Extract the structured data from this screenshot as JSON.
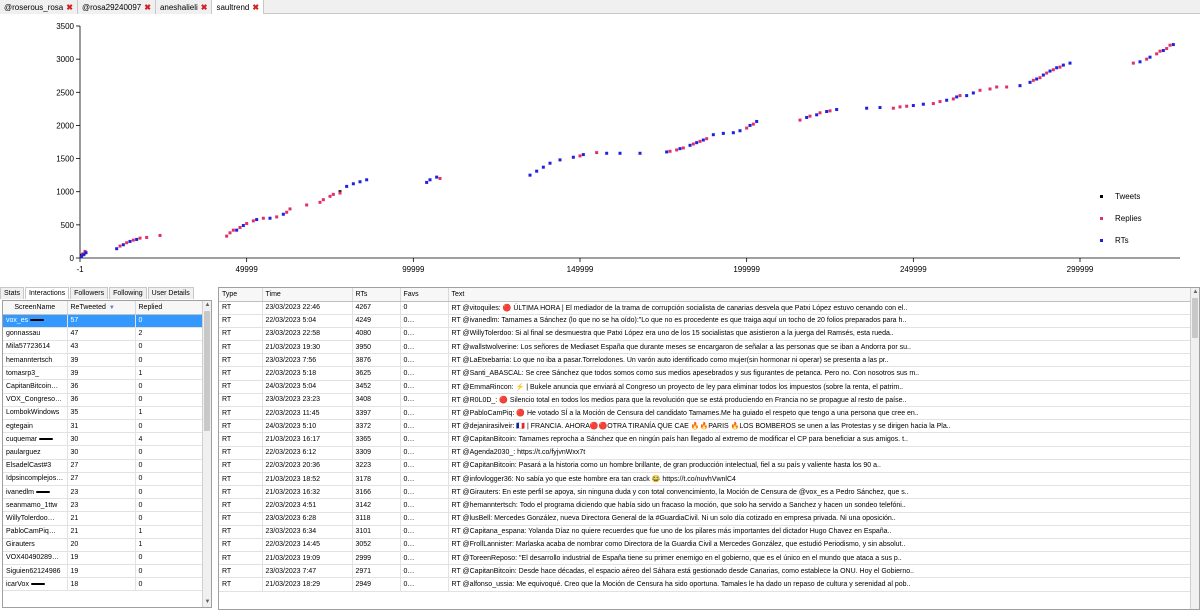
{
  "tabs": [
    {
      "label": "@roserous_rosa",
      "active": false
    },
    {
      "label": "@rosa29240097",
      "active": false
    },
    {
      "label": "aneshalieli",
      "active": false
    },
    {
      "label": "saultrend",
      "active": true
    }
  ],
  "close_icon": "close-icon",
  "chart_data": {
    "type": "scatter",
    "xlim": [
      -1,
      330000
    ],
    "ylim": [
      0,
      3500
    ],
    "x_ticks": [
      -1,
      49999,
      99999,
      149999,
      199999,
      249999,
      299999
    ],
    "x_tick_labels": [
      "-1",
      "49999",
      "99999",
      "149999",
      "199999",
      "249999",
      "299999"
    ],
    "y_ticks": [
      0,
      500,
      1000,
      1500,
      2000,
      2500,
      3000,
      3500
    ],
    "y_tick_labels": [
      "0",
      "500",
      "1000",
      "1500",
      "2000",
      "2500",
      "3000",
      "3500"
    ],
    "legend_position": "right",
    "series": [
      {
        "name": "Tweets",
        "color": "#000000",
        "points": [
          [
            500,
            40
          ],
          [
            1200,
            60
          ],
          [
            78000,
            1000
          ]
        ]
      },
      {
        "name": "Replies",
        "color": "#e0306a",
        "points": [
          [
            800,
            60
          ],
          [
            1500,
            100
          ],
          [
            12000,
            180
          ],
          [
            14000,
            230
          ],
          [
            16000,
            270
          ],
          [
            18000,
            300
          ],
          [
            20000,
            310
          ],
          [
            24000,
            340
          ],
          [
            44000,
            330
          ],
          [
            45000,
            380
          ],
          [
            46000,
            420
          ],
          [
            48000,
            460
          ],
          [
            50000,
            520
          ],
          [
            52000,
            560
          ],
          [
            55000,
            600
          ],
          [
            59000,
            620
          ],
          [
            62000,
            690
          ],
          [
            63000,
            740
          ],
          [
            68000,
            800
          ],
          [
            72000,
            840
          ],
          [
            73000,
            880
          ],
          [
            75000,
            930
          ],
          [
            76000,
            960
          ],
          [
            78000,
            980
          ],
          [
            108000,
            1200
          ],
          [
            150000,
            1540
          ],
          [
            155000,
            1590
          ],
          [
            177000,
            1610
          ],
          [
            179000,
            1630
          ],
          [
            181000,
            1660
          ],
          [
            184000,
            1720
          ],
          [
            186000,
            1760
          ],
          [
            188000,
            1800
          ],
          [
            200000,
            1960
          ],
          [
            202000,
            2020
          ],
          [
            216000,
            2080
          ],
          [
            219000,
            2140
          ],
          [
            222000,
            2190
          ],
          [
            225000,
            2220
          ],
          [
            244000,
            2260
          ],
          [
            246000,
            2280
          ],
          [
            248000,
            2290
          ],
          [
            256000,
            2330
          ],
          [
            258000,
            2360
          ],
          [
            262000,
            2400
          ],
          [
            264000,
            2450
          ],
          [
            270000,
            2530
          ],
          [
            273000,
            2550
          ],
          [
            275000,
            2580
          ],
          [
            278000,
            2580
          ],
          [
            286000,
            2680
          ],
          [
            288000,
            2720
          ],
          [
            290000,
            2790
          ],
          [
            292000,
            2840
          ],
          [
            294000,
            2880
          ],
          [
            316000,
            2940
          ],
          [
            320000,
            3000
          ],
          [
            323000,
            3080
          ],
          [
            324000,
            3120
          ],
          [
            326000,
            3160
          ],
          [
            327000,
            3210
          ]
        ]
      },
      {
        "name": "RTs",
        "color": "#2020e0",
        "points": [
          [
            400,
            20
          ],
          [
            1000,
            50
          ],
          [
            1800,
            80
          ],
          [
            11000,
            140
          ],
          [
            13000,
            200
          ],
          [
            15000,
            250
          ],
          [
            17000,
            280
          ],
          [
            47000,
            420
          ],
          [
            49000,
            490
          ],
          [
            53000,
            580
          ],
          [
            57000,
            600
          ],
          [
            61000,
            660
          ],
          [
            80000,
            1080
          ],
          [
            82000,
            1120
          ],
          [
            84000,
            1150
          ],
          [
            86000,
            1180
          ],
          [
            104000,
            1140
          ],
          [
            105000,
            1180
          ],
          [
            107000,
            1220
          ],
          [
            135000,
            1250
          ],
          [
            137000,
            1310
          ],
          [
            139000,
            1370
          ],
          [
            141000,
            1430
          ],
          [
            144000,
            1480
          ],
          [
            148000,
            1520
          ],
          [
            151000,
            1560
          ],
          [
            158000,
            1580
          ],
          [
            162000,
            1580
          ],
          [
            168000,
            1580
          ],
          [
            176000,
            1600
          ],
          [
            180000,
            1650
          ],
          [
            183000,
            1700
          ],
          [
            185000,
            1740
          ],
          [
            187000,
            1780
          ],
          [
            190000,
            1860
          ],
          [
            193000,
            1880
          ],
          [
            196000,
            1890
          ],
          [
            198000,
            1920
          ],
          [
            201000,
            2000
          ],
          [
            203000,
            2060
          ],
          [
            218000,
            2120
          ],
          [
            221000,
            2160
          ],
          [
            224000,
            2210
          ],
          [
            227000,
            2240
          ],
          [
            236000,
            2260
          ],
          [
            240000,
            2270
          ],
          [
            250000,
            2300
          ],
          [
            253000,
            2320
          ],
          [
            260000,
            2380
          ],
          [
            263000,
            2430
          ],
          [
            266000,
            2450
          ],
          [
            268000,
            2490
          ],
          [
            282000,
            2600
          ],
          [
            285000,
            2650
          ],
          [
            287000,
            2700
          ],
          [
            289000,
            2760
          ],
          [
            291000,
            2820
          ],
          [
            293000,
            2870
          ],
          [
            295000,
            2910
          ],
          [
            297000,
            2940
          ],
          [
            318000,
            2960
          ],
          [
            321000,
            3030
          ],
          [
            325000,
            3130
          ],
          [
            328000,
            3220
          ]
        ]
      }
    ]
  },
  "left_tabs": [
    {
      "label": "Stats",
      "active": false
    },
    {
      "label": "Interactions",
      "active": true
    },
    {
      "label": "Followers",
      "active": false
    },
    {
      "label": "Following",
      "active": false
    },
    {
      "label": "User Details",
      "active": false
    }
  ],
  "interactions": {
    "headers": {
      "screen_name": "ScreenName",
      "retweeted": "ReTweeted",
      "replied": "Replied"
    },
    "rows": [
      {
        "name": "vox_es",
        "rt": "57",
        "rep": "0",
        "selected": true,
        "redacted": true
      },
      {
        "name": "gonnassau",
        "rt": "47",
        "rep": "2"
      },
      {
        "name": "Mila57723614",
        "rt": "43",
        "rep": "0"
      },
      {
        "name": "hemanntertsch",
        "rt": "39",
        "rep": "0"
      },
      {
        "name": "tomasrp3_",
        "rt": "39",
        "rep": "1"
      },
      {
        "name": "CapitanBitcoin",
        "rt": "36",
        "rep": "0",
        "redacted": true
      },
      {
        "name": "VOX_Congreso",
        "rt": "36",
        "rep": "0",
        "redacted": true
      },
      {
        "name": "LombokWindows",
        "rt": "35",
        "rep": "1"
      },
      {
        "name": "egtegain",
        "rt": "31",
        "rep": "0"
      },
      {
        "name": "cuquemar",
        "rt": "30",
        "rep": "4",
        "redacted": true
      },
      {
        "name": "paularguez",
        "rt": "30",
        "rep": "0"
      },
      {
        "name": "ElsadelCast#3",
        "rt": "27",
        "rep": "0"
      },
      {
        "name": "Idpsincomplejos",
        "rt": "27",
        "rep": "0",
        "redacted": true
      },
      {
        "name": "ivanedlm",
        "rt": "23",
        "rep": "0",
        "redacted": true
      },
      {
        "name": "seanmamo_1ttw",
        "rt": "23",
        "rep": "0"
      },
      {
        "name": "WillyTolerdoo",
        "rt": "21",
        "rep": "0",
        "redacted": true
      },
      {
        "name": "PabloCamPiq",
        "rt": "21",
        "rep": "1",
        "redacted": true
      },
      {
        "name": "Girauters",
        "rt": "20",
        "rep": "1"
      },
      {
        "name": "VOX40490289",
        "rt": "19",
        "rep": "0",
        "redacted": true
      },
      {
        "name": "Siguien62124986",
        "rt": "19",
        "rep": "0"
      },
      {
        "name": "icarVox",
        "rt": "18",
        "rep": "0",
        "redacted": true
      }
    ]
  },
  "tweets": {
    "headers": {
      "type": "Type",
      "time": "Time",
      "rts": "RTs",
      "favs": "Favs",
      "text": "Text"
    },
    "rows": [
      {
        "type": "RT",
        "time": "23/03/2023 22:46",
        "rts": "4267",
        "favs": "0",
        "text": "RT @vitoquiles: 🔴 ÚLTIMA HORA | El mediador de la trama de corrupción socialista de canarias desvela que Patxi López estuvo cenando con el..",
        "mark": false
      },
      {
        "type": "RT",
        "time": "22/03/2023 5:04",
        "rts": "4249",
        "favs": "0",
        "text": "RT @ivanedlm: Tamames a Sánchez (lo que no se ha oído):\"Lo que no es procedente es que traiga aquí un tocho de 20 folios preparados para h..",
        "mark": true
      },
      {
        "type": "RT",
        "time": "23/03/2023 22:58",
        "rts": "4080",
        "favs": "0",
        "text": "RT @WillyTolerdoo: Si al final se desmuestra que Patxi López era uno de los 15 socialistas que asistieron a la juerga del Ramsés, esta rueda..",
        "mark": true
      },
      {
        "type": "RT",
        "time": "21/03/2023 19:30",
        "rts": "3950",
        "favs": "0",
        "text": "RT @wallstwolverine: Los señores de Mediaset España que durante meses se encargaron de señalar a las personas que se iban a Andorra por su..",
        "mark": true
      },
      {
        "type": "RT",
        "time": "23/03/2023 7:56",
        "rts": "3876",
        "favs": "0",
        "text": "RT @LaEtxebarria: Lo que no iba a pasar.Torrelodones. Un varón auto identificado como mujer(sin hormonar ni operar) se presenta a las pr..",
        "mark": true
      },
      {
        "type": "RT",
        "time": "22/03/2023 5:18",
        "rts": "3625",
        "favs": "0",
        "text": "RT @Santi_ABASCAL: Se cree Sánchez que todos somos como sus medios apesebrados y sus figurantes de petanca. Pero no. Con nosotros sus m..",
        "mark": true
      },
      {
        "type": "RT",
        "time": "24/03/2023 5:04",
        "rts": "3452",
        "favs": "0",
        "text": "RT @EmmaRincon: ⚡ | Bukele anuncia que enviará al Congreso un proyecto de ley para eliminar todos los impuestos (sobre la renta, el patrim..",
        "mark": true
      },
      {
        "type": "RT",
        "time": "23/03/2023 23:23",
        "rts": "3408",
        "favs": "0",
        "text": "RT @R0L0D_: 🔴 Silencio total en todos los medios para que la revolución que se está produciendo en Francia no se propague al resto de paíse..",
        "mark": true
      },
      {
        "type": "RT",
        "time": "22/03/2023 11:45",
        "rts": "3397",
        "favs": "0",
        "text": "RT @PabloCamPiq: 🔴 He votado SÍ a la Moción de Censura del candidato Tamames.Me ha guiado el respeto que tengo a una persona que cree en..",
        "mark": true
      },
      {
        "type": "RT",
        "time": "24/03/2023 5:10",
        "rts": "3372",
        "favs": "0",
        "text": "RT @dejanirasilveir: 🇫🇷 | FRANCIA. AHORA🔴🔴OTRA TIRANÍA QUE CAE 🔥🔥PARIS 🔥LOS BOMBEROS se unen a las Protestas y se dirigen hacia la Pla..",
        "mark": true
      },
      {
        "type": "RT",
        "time": "21/03/2023 16:17",
        "rts": "3365",
        "favs": "0",
        "text": "RT @CapitanBitcoin: Tamames reprocha a Sánchez que en ningún país han llegado al extremo de modificar el CP para beneficiar a sus amigos. t..",
        "mark": true
      },
      {
        "type": "RT",
        "time": "22/03/2023 6:12",
        "rts": "3309",
        "favs": "0",
        "text": "RT @Agenda2030_: https://t.co/fyjvnWxx7t",
        "mark": true
      },
      {
        "type": "RT",
        "time": "22/03/2023 20:36",
        "rts": "3223",
        "favs": "0",
        "text": "RT @CapitanBitcoin: Pasará a la historia como un hombre brillante, de gran producción intelectual, fiel a su país y valiente hasta los 90 a..",
        "mark": true
      },
      {
        "type": "RT",
        "time": "21/03/2023 18:52",
        "rts": "3178",
        "favs": "0",
        "text": "RT @infovlogger36: No sabía yo que este hombre era tan crack 😂 https://t.co/nuvhVwnlC4",
        "mark": true
      },
      {
        "type": "RT",
        "time": "21/03/2023 16:32",
        "rts": "3166",
        "favs": "0",
        "text": "RT @Girauters: En este perfil se apoya, sin ninguna duda y con total convencimiento, la Moción de Censura de @vox_es a Pedro Sánchez, que s..",
        "mark": true
      },
      {
        "type": "RT",
        "time": "22/03/2023 4:51",
        "rts": "3142",
        "favs": "0",
        "text": "RT @hemanntertsch: Todo el programa diciendo que había sido un fracaso la moción, que solo ha servido a Sanchez y hacen un sondeo telefóni..",
        "mark": true
      },
      {
        "type": "RT",
        "time": "23/03/2023 6:28",
        "rts": "3118",
        "favs": "0",
        "text": "RT @lusBell: Mercedes González, nueva Directora General de la #GuardiaCivil. Ni un solo día cotizado en empresa privada. Ni una oposición..",
        "mark": true
      },
      {
        "type": "RT",
        "time": "23/03/2023 6:34",
        "rts": "3101",
        "favs": "0",
        "text": "RT @Capitana_espana: Yolanda Díaz no quiere  recuerdes que fue uno de los pilares más importantes del dictador Hugo Chavez  en España..",
        "mark": true
      },
      {
        "type": "RT",
        "time": "22/03/2023 14:45",
        "rts": "3052",
        "favs": "0",
        "text": "RT @FrollLannister: Marlaska acaba de nombrar como Directora de la Guardia Civil a Mercedes González, que estudió Periodismo, y sin absolut..",
        "mark": true
      },
      {
        "type": "RT",
        "time": "21/03/2023 19:09",
        "rts": "2999",
        "favs": "0",
        "text": "RT @ToreenReposo: \"El desarrollo industrial de España tiene su primer enemigo en el gobierno, que es el único en el mundo que ataca a sus p..",
        "mark": true
      },
      {
        "type": "RT",
        "time": "23/03/2023 7:47",
        "rts": "2971",
        "favs": "0",
        "text": "RT @CapitanBitcoin: Desde hace décadas, el espacio aéreo del Sáhara está gestionado desde Canarias, como establece la ONU. Hoy el Gobierno..",
        "mark": true
      },
      {
        "type": "RT",
        "time": "21/03/2023 18:29",
        "rts": "2949",
        "favs": "0",
        "text": "RT @alfonso_ussia: Me equivoqué. Creo que la Moción de Censura ha sido oportuna. Tamales le ha dado un repaso de cultura y serenidad al pob..",
        "mark": true
      }
    ]
  }
}
